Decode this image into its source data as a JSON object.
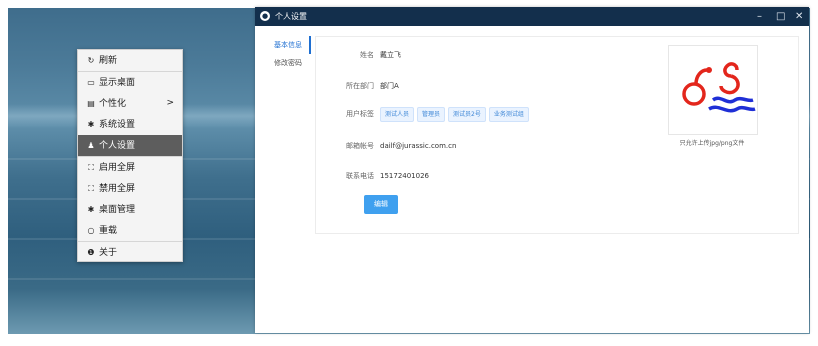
{
  "desktop": {
    "context_menu": {
      "items": [
        {
          "icon": "refresh-icon",
          "glyph": "↻",
          "label": "刷新"
        },
        {
          "icon": "monitor-icon",
          "glyph": "▭",
          "label": "显示桌面"
        },
        {
          "icon": "personalize-icon",
          "glyph": "▤",
          "label": "个性化",
          "submenu": ">"
        },
        {
          "icon": "gear-icon",
          "glyph": "✱",
          "label": "系统设置"
        },
        {
          "icon": "user-icon",
          "glyph": "♟",
          "label": "个人设置"
        },
        {
          "icon": "fullscreen-icon",
          "glyph": "⛶",
          "label": "启用全屏"
        },
        {
          "icon": "exit-fullscreen-icon",
          "glyph": "⛶",
          "label": "禁用全屏"
        },
        {
          "icon": "gear-icon",
          "glyph": "✱",
          "label": "桌面管理"
        },
        {
          "icon": "power-icon",
          "glyph": "○",
          "label": "重载"
        },
        {
          "icon": "info-icon",
          "glyph": "❶",
          "label": "关于"
        }
      ]
    }
  },
  "window": {
    "title": "个人设置",
    "controls": {
      "minimize": "–",
      "maximize": "□",
      "close": "✕"
    },
    "tabs": [
      {
        "label": "基本信息",
        "active": true
      },
      {
        "label": "修改密码",
        "active": false
      }
    ],
    "profile": {
      "name_label": "姓名",
      "name": "戴立飞",
      "dept_label": "所在部门",
      "dept": "部门A",
      "tags_label": "用户标签",
      "tags": [
        "测试人员",
        "管理员",
        "测试员2号",
        "业务测试组"
      ],
      "email_label": "邮箱帐号",
      "email": "dailf@jurassic.com.cn",
      "phone_label": "联系电话",
      "phone": "15172401026",
      "edit_button": "编辑",
      "upload_hint": "只允许上传jpg/png文件"
    }
  },
  "colors": {
    "titlebar": "#132f4c",
    "accent": "#1f6fd1",
    "button": "#3fa0ef",
    "logo_red": "#e3261c",
    "logo_blue": "#1f2fd6"
  }
}
